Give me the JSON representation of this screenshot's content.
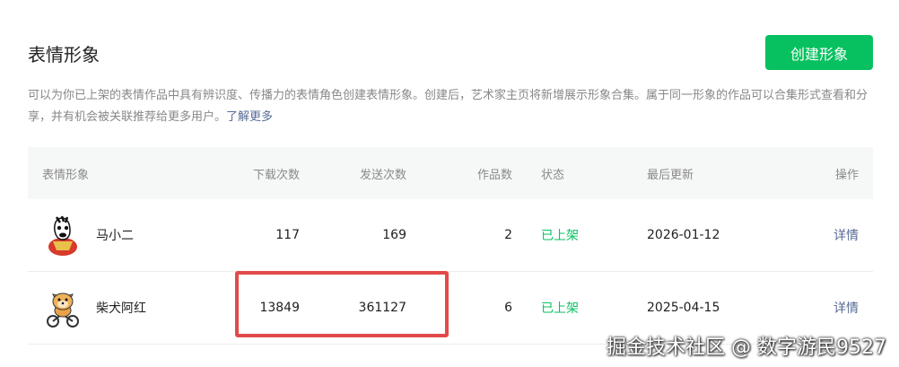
{
  "page": {
    "title": "表情形象",
    "create_button": "创建形象",
    "description": "可以为你已上架的表情作品中具有辨识度、传播力的表情角色创建表情形象。创建后，艺术家主页将新增展示形象合集。属于同一形象的作品可以合集形式查看和分享，并有机会被关联推荐给更多用户。",
    "learn_more": "了解更多"
  },
  "table": {
    "headers": {
      "name": "表情形象",
      "downloads": "下载次数",
      "sends": "发送次数",
      "works": "作品数",
      "status": "状态",
      "updated": "最后更新",
      "actions": "操作"
    },
    "rows": [
      {
        "avatar_icon": "horse-character-icon",
        "name": "马小二",
        "downloads": "117",
        "sends": "169",
        "works": "2",
        "status": "已上架",
        "updated": "2026-01-12",
        "action": "详情"
      },
      {
        "avatar_icon": "shiba-cyclist-icon",
        "name": "柴犬阿红",
        "downloads": "13849",
        "sends": "361127",
        "works": "6",
        "status": "已上架",
        "updated": "2025-04-15",
        "action": "详情"
      }
    ]
  },
  "colors": {
    "brand_green": "#07c160",
    "link_blue": "#576b95",
    "highlight_red": "#e24a4a"
  },
  "watermark": "掘金技术社区 @ 数字游民9527"
}
